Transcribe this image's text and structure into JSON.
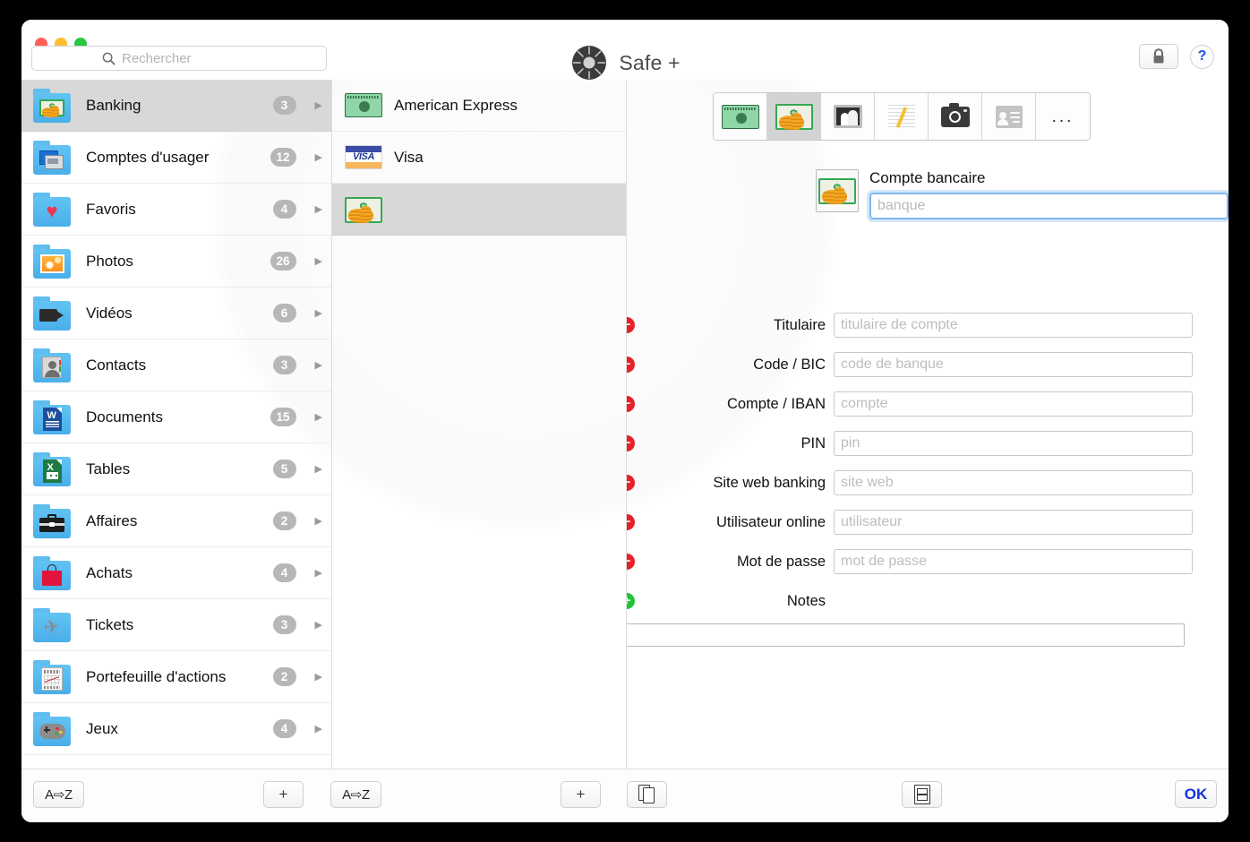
{
  "window": {
    "title": "Safe +",
    "app_icon": "safe-dial-icon",
    "traffic_lights": [
      "close",
      "minimize",
      "zoom"
    ]
  },
  "search": {
    "placeholder": "Rechercher",
    "value": "",
    "icon": "search-icon"
  },
  "titlebar_buttons": {
    "lock_icon": "lock-icon",
    "help_label": "?"
  },
  "sidebar": {
    "items": [
      {
        "label": "Banking",
        "count": "3",
        "icon": "money-folder-icon",
        "selected": true
      },
      {
        "label": "Comptes d'usager",
        "count": "12",
        "icon": "windows-folder-icon",
        "selected": false
      },
      {
        "label": "Favoris",
        "count": "4",
        "icon": "heart-folder-icon",
        "selected": false
      },
      {
        "label": "Photos",
        "count": "26",
        "icon": "photo-folder-icon",
        "selected": false
      },
      {
        "label": "Vidéos",
        "count": "6",
        "icon": "video-folder-icon",
        "selected": false
      },
      {
        "label": "Contacts",
        "count": "3",
        "icon": "contact-folder-icon",
        "selected": false
      },
      {
        "label": "Documents",
        "count": "15",
        "icon": "word-folder-icon",
        "selected": false
      },
      {
        "label": "Tables",
        "count": "5",
        "icon": "excel-folder-icon",
        "selected": false
      },
      {
        "label": "Affaires",
        "count": "2",
        "icon": "briefcase-folder-icon",
        "selected": false
      },
      {
        "label": "Achats",
        "count": "4",
        "icon": "shopping-folder-icon",
        "selected": false
      },
      {
        "label": "Tickets",
        "count": "3",
        "icon": "airplane-folder-icon",
        "selected": false
      },
      {
        "label": "Portefeuille d'actions",
        "count": "2",
        "icon": "chart-folder-icon",
        "selected": false
      },
      {
        "label": "Jeux",
        "count": "4",
        "icon": "gamepad-folder-icon",
        "selected": false
      }
    ]
  },
  "list": {
    "items": [
      {
        "label": "American Express",
        "icon": "amex-card-icon",
        "selected": false
      },
      {
        "label": "Visa",
        "icon": "visa-card-icon",
        "selected": false
      },
      {
        "label": "",
        "icon": "money-icon",
        "selected": true
      }
    ]
  },
  "detail": {
    "type_toolbar": [
      {
        "icon": "credit-card-icon",
        "selected": false
      },
      {
        "icon": "money-icon",
        "selected": true
      },
      {
        "icon": "photo-frame-icon",
        "selected": false
      },
      {
        "icon": "note-pencil-icon",
        "selected": false
      },
      {
        "icon": "camera-icon",
        "selected": false
      },
      {
        "icon": "contact-card-icon",
        "selected": false
      },
      {
        "icon": "more-ellipsis-icon",
        "label": "...",
        "selected": false
      }
    ],
    "account": {
      "icon": "money-icon",
      "title": "Compte bancaire",
      "name_placeholder": "banque",
      "name_value": "",
      "focused": true
    },
    "fields": [
      {
        "label": "Titulaire",
        "placeholder": "titulaire de compte",
        "value": "",
        "action": "remove"
      },
      {
        "label": "Code / BIC",
        "placeholder": "code de banque",
        "value": "",
        "action": "remove"
      },
      {
        "label": "Compte / IBAN",
        "placeholder": "compte",
        "value": "",
        "action": "remove"
      },
      {
        "label": "PIN",
        "placeholder": "pin",
        "value": "",
        "action": "remove"
      },
      {
        "label": "Site web banking",
        "placeholder": "site web",
        "value": "",
        "action": "remove"
      },
      {
        "label": "Utilisateur online",
        "placeholder": "utilisateur",
        "value": "",
        "action": "remove"
      },
      {
        "label": "Mot de passe",
        "placeholder": "mot de passe",
        "value": "",
        "action": "remove"
      }
    ],
    "notes": {
      "label": "Notes",
      "action": "add",
      "value": "",
      "placeholder": ""
    }
  },
  "bottom_bar": {
    "sidebar_sort_label": "A⇨Z",
    "sidebar_add_label": "+",
    "list_sort_label": "A⇨Z",
    "list_add_label": "+",
    "duplicate_icon": "duplicate-document-icon",
    "template_icon": "list-template-icon",
    "ok_label": "OK"
  },
  "colors": {
    "accent_blue": "#1430e0",
    "focus_ring": "#82b6f0",
    "remove_red": "#e8202a",
    "add_green": "#23c23a",
    "folder_blue": "#4aaeea",
    "selection_gray": "#d8d8d8"
  }
}
